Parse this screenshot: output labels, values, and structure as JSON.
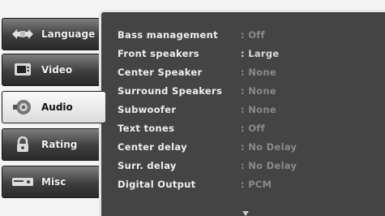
{
  "tabs": [
    {
      "label": "Language",
      "icon": "speaker-arrows-icon"
    },
    {
      "label": "Video",
      "icon": "tv-icon"
    },
    {
      "label": "Audio",
      "icon": "speaker-icon",
      "active": true
    },
    {
      "label": "Rating",
      "icon": "lock-icon"
    },
    {
      "label": "Misc",
      "icon": "dvd-player-icon"
    }
  ],
  "settings": [
    {
      "label": "Bass management",
      "value": ": Off"
    },
    {
      "label": "Front speakers",
      "value": ": Large"
    },
    {
      "label": "Center Speaker",
      "value": ": None"
    },
    {
      "label": "Surround Speakers",
      "value": ": None"
    },
    {
      "label": "Subwoofer",
      "value": ": None"
    },
    {
      "label": "Text tones",
      "value": ": Off"
    },
    {
      "label": "Center delay",
      "value": ": No Delay"
    },
    {
      "label": "Surr. delay",
      "value": ": No Delay"
    },
    {
      "label": "Digital Output",
      "value": ": PCM"
    }
  ],
  "colors": {
    "panel_bg": "#444444",
    "tab_active_bg": "#eeeeee",
    "tab_inactive_bg": "#3e3e3e"
  }
}
